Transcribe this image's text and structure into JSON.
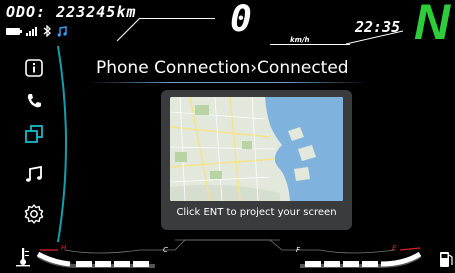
{
  "status_bar": {
    "odometer": "ODO: 223245km",
    "speed": "0",
    "speed_unit": "km/h",
    "clock": "22:35",
    "gear": "N",
    "gear_color": "#2ecb3a"
  },
  "status_icons": [
    "battery-icon",
    "signal-icon",
    "bluetooth-icon",
    "music-note-icon"
  ],
  "sidebar": {
    "accent_color": "#19b8c8",
    "items": [
      {
        "icon": "info-icon",
        "selected": false
      },
      {
        "icon": "phone-icon",
        "selected": false
      },
      {
        "icon": "phone-projection-icon",
        "selected": true
      },
      {
        "icon": "music-icon",
        "selected": false
      },
      {
        "icon": "settings-icon",
        "selected": false
      }
    ]
  },
  "main": {
    "title": "Phone Connection›Connected",
    "card_message": "Click ENT to project your screen"
  },
  "gauges": {
    "temp_hot": "H",
    "temp_cold": "C",
    "fuel_full": "F",
    "fuel_empty": "E"
  }
}
